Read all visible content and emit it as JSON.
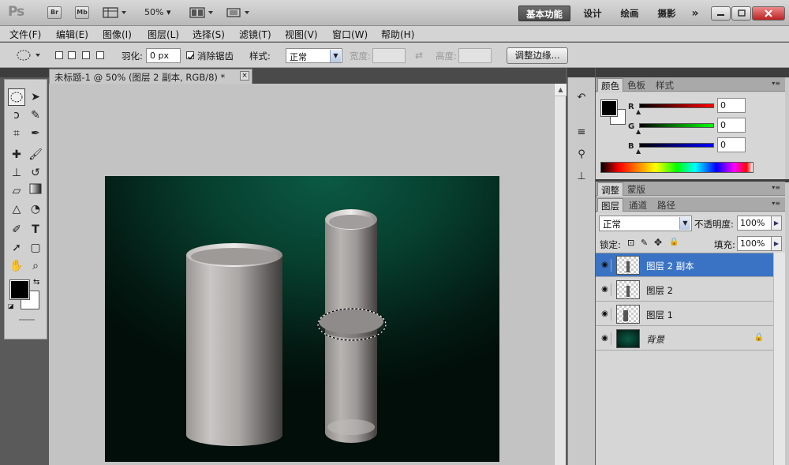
{
  "app": {
    "logo": "Ps",
    "bridge_btn": "Br",
    "minibridge_btn": "Mb",
    "zoom": "50%",
    "workspaces": {
      "basic": "基本功能",
      "design": "设计",
      "paint": "绘画",
      "photo": "摄影",
      "more": "»"
    }
  },
  "menu": [
    "文件(F)",
    "编辑(E)",
    "图像(I)",
    "图层(L)",
    "选择(S)",
    "滤镜(T)",
    "视图(V)",
    "窗口(W)",
    "帮助(H)"
  ],
  "options": {
    "feather_label": "羽化:",
    "feather_value": "0 px",
    "antialias_label": "消除锯齿",
    "style_label": "样式:",
    "style_value": "正常",
    "width_label": "宽度:",
    "height_label": "高度:",
    "refine_edge": "调整边缘..."
  },
  "document": {
    "tab_title": "未标题-1 @ 50% (图层 2 副本, RGB/8) *",
    "close": "×"
  },
  "color_panel": {
    "tabs": [
      "颜色",
      "色板",
      "样式"
    ],
    "r_label": "R",
    "g_label": "G",
    "b_label": "B",
    "r_value": "0",
    "g_value": "0",
    "b_value": "0"
  },
  "adjust_panel": {
    "tabs": [
      "调整",
      "蒙版"
    ]
  },
  "layers_panel": {
    "tabs": [
      "图层",
      "通道",
      "路径"
    ],
    "blend_mode": "正常",
    "opacity_label": "不透明度:",
    "opacity_value": "100%",
    "lock_label": "锁定:",
    "fill_label": "填充:",
    "fill_value": "100%",
    "layers": [
      {
        "name": "图层 2 副本",
        "selected": true
      },
      {
        "name": "图层 2",
        "selected": false
      },
      {
        "name": "图层 1",
        "selected": false
      },
      {
        "name": "背景",
        "selected": false
      }
    ]
  },
  "colors": {
    "selection_blue": "#3a73c4",
    "canvas_green": "#0b5a44",
    "foreground": "#000000",
    "background": "#ffffff"
  }
}
